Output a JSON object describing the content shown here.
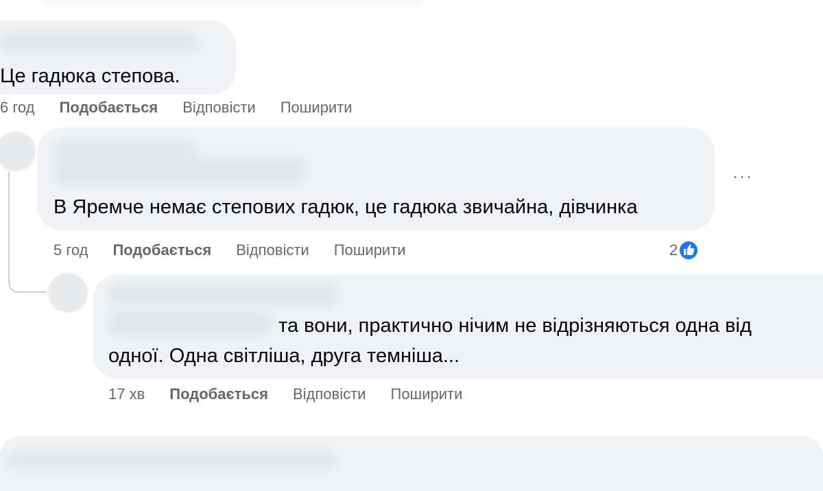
{
  "comments": [
    {
      "text": "Це гадюка степова.",
      "time": "6 год",
      "like_label": "Подобається",
      "reply_label": "Відповісти",
      "share_label": "Поширити"
    },
    {
      "text": "В Яремче немає степових гадюк, це гадюка звичайна, дівчинка",
      "time": "5 год",
      "like_label": "Подобається",
      "reply_label": "Відповісти",
      "share_label": "Поширити",
      "reactions_count": "2",
      "menu_label": "···"
    },
    {
      "text_line1": "та вони, практично нічим не відрізняються одна від",
      "text_line2": "одної. Одна світліша, друга темніша...",
      "time": "17 хв",
      "like_label": "Подобається",
      "reply_label": "Відповісти",
      "share_label": "Поширити"
    }
  ],
  "colors": {
    "bubble": "#f0f2f5",
    "meta_text": "#65676b",
    "like_reaction": "#1877f2"
  },
  "icons": [
    "like-reaction-icon",
    "more-options-icon"
  ]
}
